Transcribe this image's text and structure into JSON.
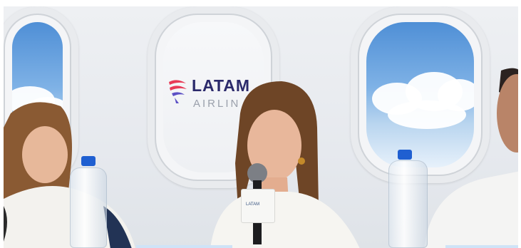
{
  "logo": {
    "name": "LATAM",
    "subtitle": "AIRLIN",
    "colors": {
      "primary": "#2b2a6b",
      "accent1": "#e83a57",
      "accent2": "#5b4fc4",
      "secondary_text": "#9aa0ab"
    }
  },
  "mic_cube": {
    "label": "LATAM"
  },
  "scene": {
    "bottle_cap_color": "#1f5fd1",
    "sky_color": "#7fb2e6"
  }
}
